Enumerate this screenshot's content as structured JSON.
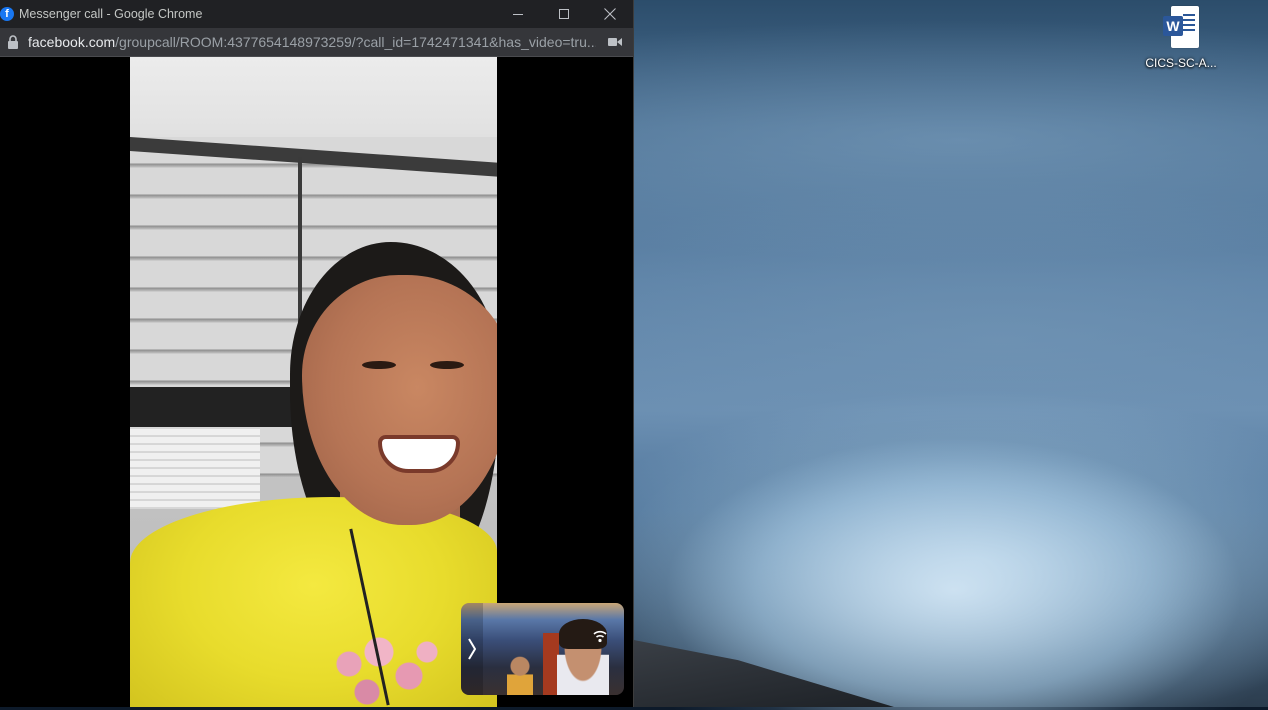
{
  "window": {
    "title": "Messenger call - Google Chrome",
    "favicon_letter": "f",
    "controls": {
      "minimize": "minimize-icon",
      "maximize": "maximize-icon",
      "close": "close-icon"
    }
  },
  "address_bar": {
    "domain": "facebook.com",
    "path": "/groupcall/ROOM:4377654148973259/?call_id=1742471341&has_video=tru...",
    "lock_icon": "lock-icon",
    "camera_icon": "camera-icon"
  },
  "call": {
    "remote_participant": "remote-video-feed",
    "self_view": "self-view-feed",
    "expand_icon": "chevron-right-icon",
    "signal_icon": "connection-signal-icon"
  },
  "desktop": {
    "icons": [
      {
        "label": "CICS-SC-A...",
        "badge": "W",
        "icon": "word-document-icon"
      }
    ]
  },
  "colors": {
    "titlebar": "#202124",
    "addressbar": "#35363a",
    "facebook_blue": "#1877f2",
    "word_blue": "#2b579a"
  }
}
